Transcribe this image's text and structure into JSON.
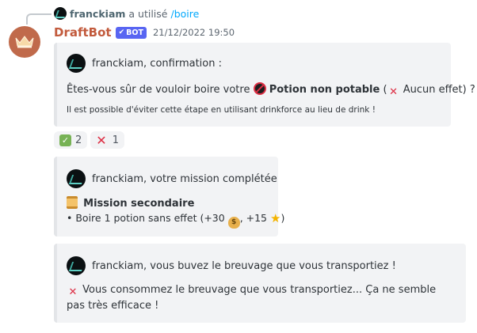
{
  "reply": {
    "username": "franckiam",
    "action_text": "a utilisé",
    "command": "/boire"
  },
  "message": {
    "author": "DraftBot",
    "bot_tag": "BOT",
    "timestamp": "21/12/2022 19:50"
  },
  "embed1": {
    "author": "franckiam, confirmation :",
    "question_prefix": "Êtes-vous sûr de vouloir boire votre",
    "potion_name": "Potion non potable",
    "paren_open": "(",
    "effect": "Aucun effet)",
    "question_suffix": "?",
    "hint": "Il est possible d'éviter cette étape en utilisant drinkforce au lieu de drink !"
  },
  "reactions": [
    {
      "emoji": "check-mark-button",
      "count": "2"
    },
    {
      "emoji": "cross-mark",
      "count": "1"
    }
  ],
  "embed2": {
    "author": "franckiam, votre mission complétée",
    "mission_title": "Mission secondaire",
    "mission_detail_prefix": "• Boire 1 potion sans effet (+30",
    "mission_detail_mid": ", +15",
    "mission_detail_suffix": ")"
  },
  "embed3": {
    "author": "franckiam, vous buvez le breuvage que vous transportiez !",
    "description": "Vous consommez le breuvage que vous transportiez... Ça ne semble pas très efficace !"
  },
  "colors": {
    "author": "#c25a3c",
    "bot_tag": "#5865f2",
    "command": "#00a8fc",
    "embed_bg": "#f2f3f5"
  }
}
